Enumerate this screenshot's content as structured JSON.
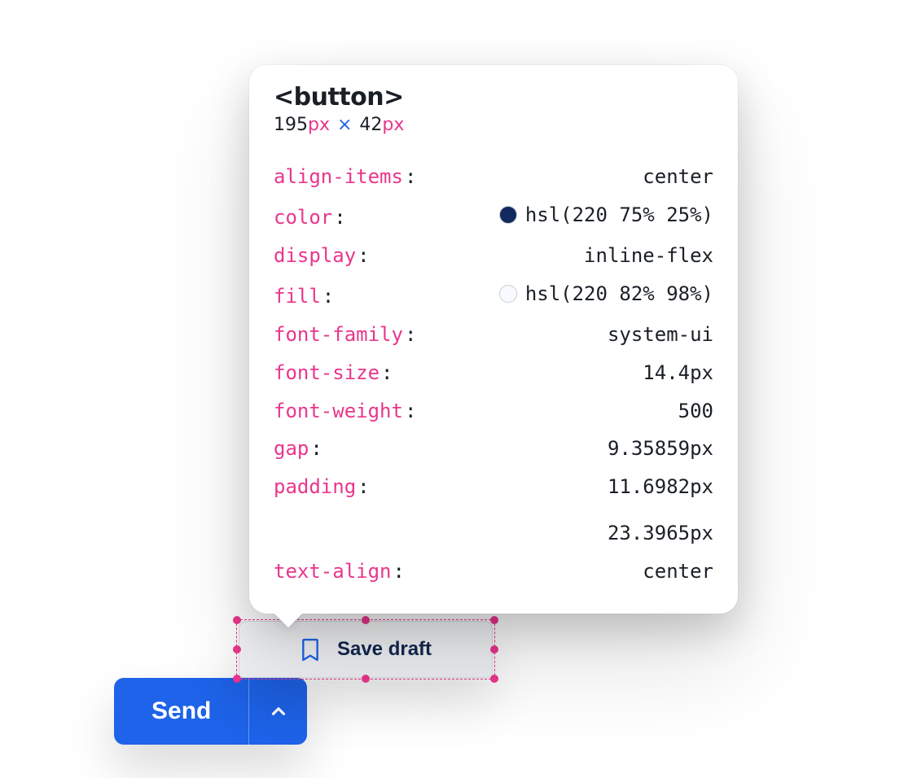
{
  "inspector": {
    "tag": "<button>",
    "dims": {
      "w": "195",
      "h": "42",
      "unit": "px"
    },
    "props": [
      {
        "key": "align-items",
        "value": "center"
      },
      {
        "key": "color",
        "value": "hsl(220 75% 25%)",
        "swatch": "#122a5e"
      },
      {
        "key": "display",
        "value": "inline-flex"
      },
      {
        "key": "fill",
        "value": "hsl(220 82% 98%)",
        "swatch": "#f7faff"
      },
      {
        "key": "font-family",
        "value": "system-ui"
      },
      {
        "key": "font-size",
        "value": "14.4px"
      },
      {
        "key": "font-weight",
        "value": "500"
      },
      {
        "key": "gap",
        "value": "9.35859px"
      },
      {
        "key": "padding",
        "value": "11.6982px\n23.3965px"
      },
      {
        "key": "text-align",
        "value": "center"
      }
    ]
  },
  "selected_button": {
    "label": "Save draft"
  },
  "send": {
    "label": "Send"
  }
}
